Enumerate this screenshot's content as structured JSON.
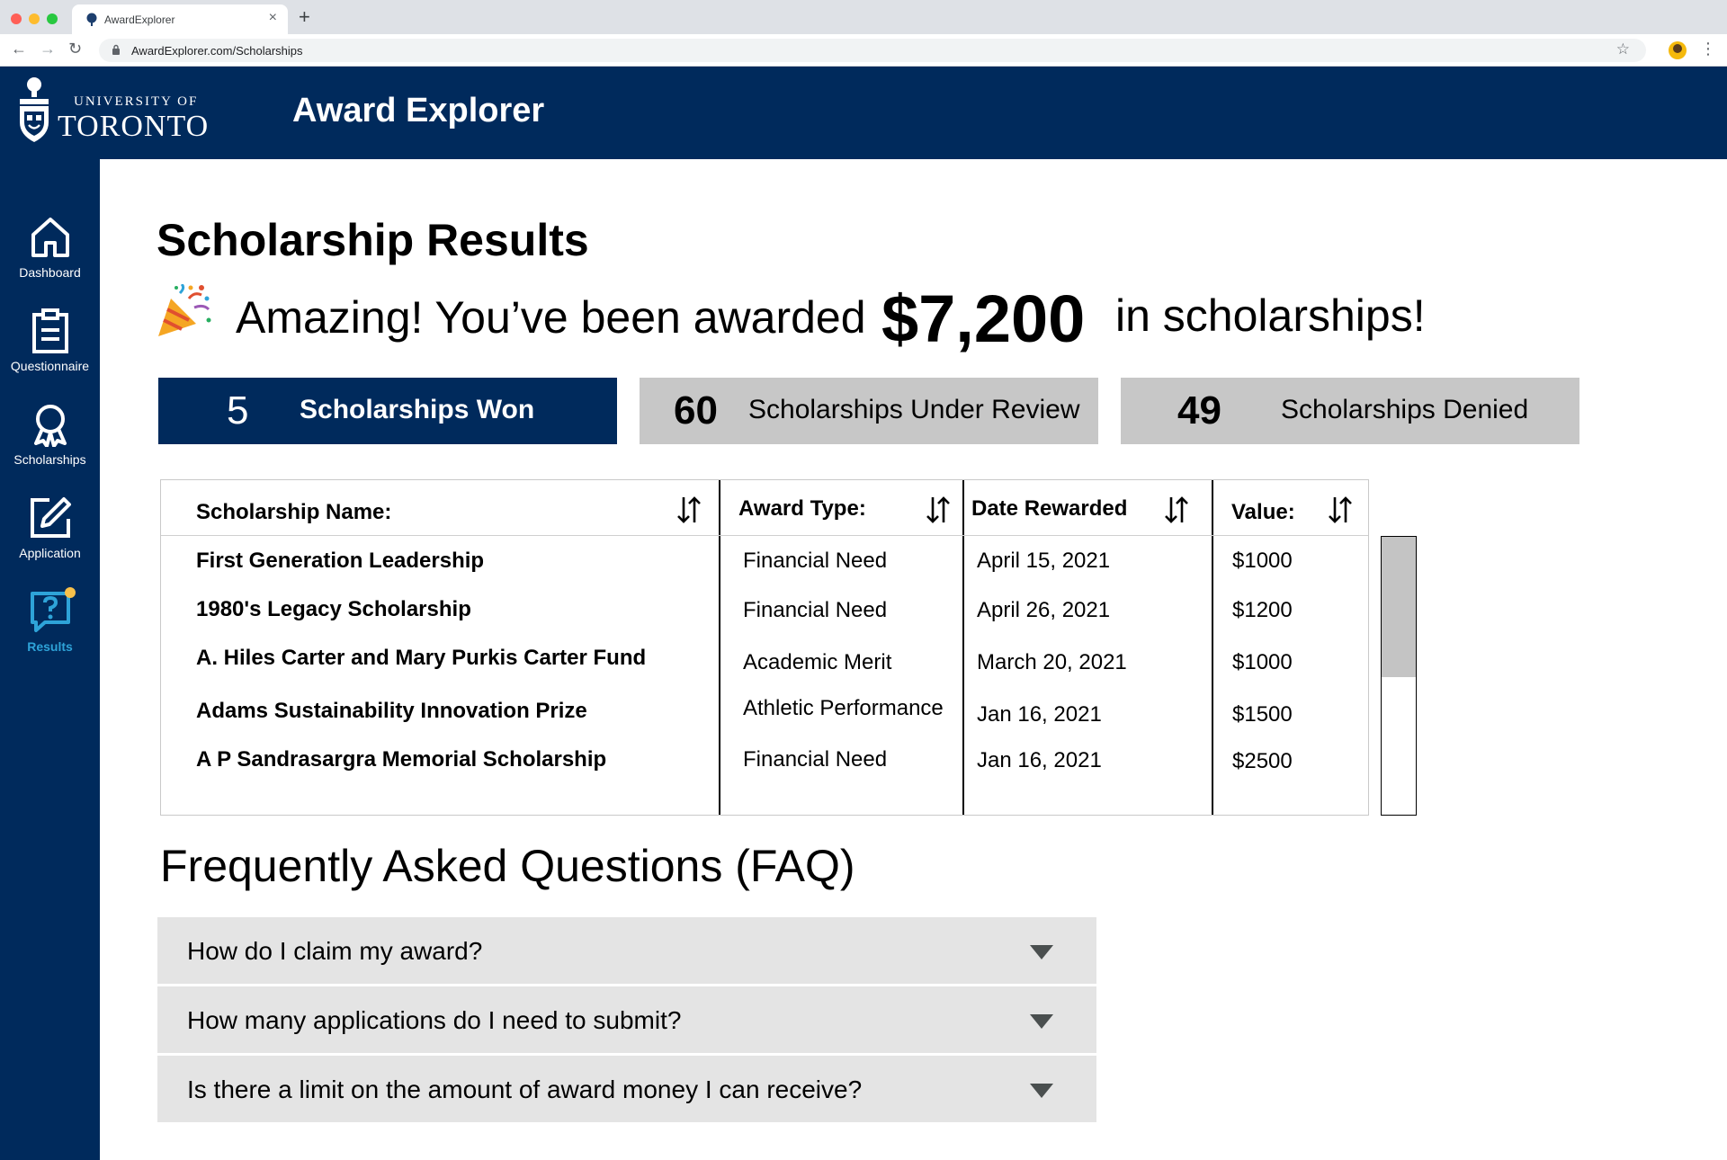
{
  "browser": {
    "tab_title": "AwardExplorer",
    "tab_close": "×",
    "new_tab": "+",
    "url": "AwardExplorer.com/Scholarships",
    "back": "←",
    "forward": "→",
    "reload": "↻",
    "bookmark": "☆",
    "menu": "⋮"
  },
  "header": {
    "university_line1": "UNIVERSITY OF",
    "university_line2": "TORONTO",
    "app_title": "Award Explorer"
  },
  "sidebar": {
    "items": [
      {
        "label": "Dashboard",
        "icon": "home-icon"
      },
      {
        "label": "Questionnaire",
        "icon": "clipboard-icon"
      },
      {
        "label": "Scholarships",
        "icon": "award-ribbon-icon"
      },
      {
        "label": "Application",
        "icon": "edit-icon"
      },
      {
        "label": "Results",
        "icon": "question-chat-icon",
        "active": true,
        "has_notification": true
      }
    ]
  },
  "main": {
    "title": "Scholarship Results",
    "message_part1": "Amazing! You’ve been awarded",
    "message_amount": "$7,200",
    "message_part2": "in scholarships!",
    "stats": [
      {
        "count": "5",
        "label": "Scholarships Won",
        "active": true
      },
      {
        "count": "60",
        "label": "Scholarships Under Review"
      },
      {
        "count": "49",
        "label": "Scholarships Denied"
      }
    ]
  },
  "table": {
    "columns": [
      "Scholarship Name:",
      "Award Type:",
      "Date Rewarded",
      "Value:"
    ],
    "rows": [
      {
        "name": "First Generation Leadership",
        "type": "Financial Need",
        "date": "April 15, 2021",
        "value": "$1000"
      },
      {
        "name": "1980's Legacy Scholarship",
        "type": "Financial Need",
        "date": "April 26, 2021",
        "value": "$1200"
      },
      {
        "name": "A. Hiles Carter and Mary Purkis Carter Fund",
        "type": "Academic Merit",
        "date": "March 20, 2021",
        "value": "$1000"
      },
      {
        "name": "Adams Sustainability Innovation Prize",
        "type": "Athletic Performance",
        "date": "Jan 16, 2021",
        "value": "$1500"
      },
      {
        "name": "A P Sandrasargra Memorial Scholarship",
        "type": "Financial Need",
        "date": "Jan 16, 2021",
        "value": "$2500"
      }
    ]
  },
  "faq": {
    "title": "Frequently Asked Questions (FAQ)",
    "questions": [
      "How do I claim my award?",
      "How many applications do I need to submit?",
      "Is there a limit on the amount of award money I can receive?"
    ]
  },
  "colors": {
    "navy": "#002a5c",
    "active_link": "#2ea3d8",
    "card_gray": "#c7c7c7",
    "faq_gray": "#e4e4e4",
    "notification": "#f7c04a"
  }
}
